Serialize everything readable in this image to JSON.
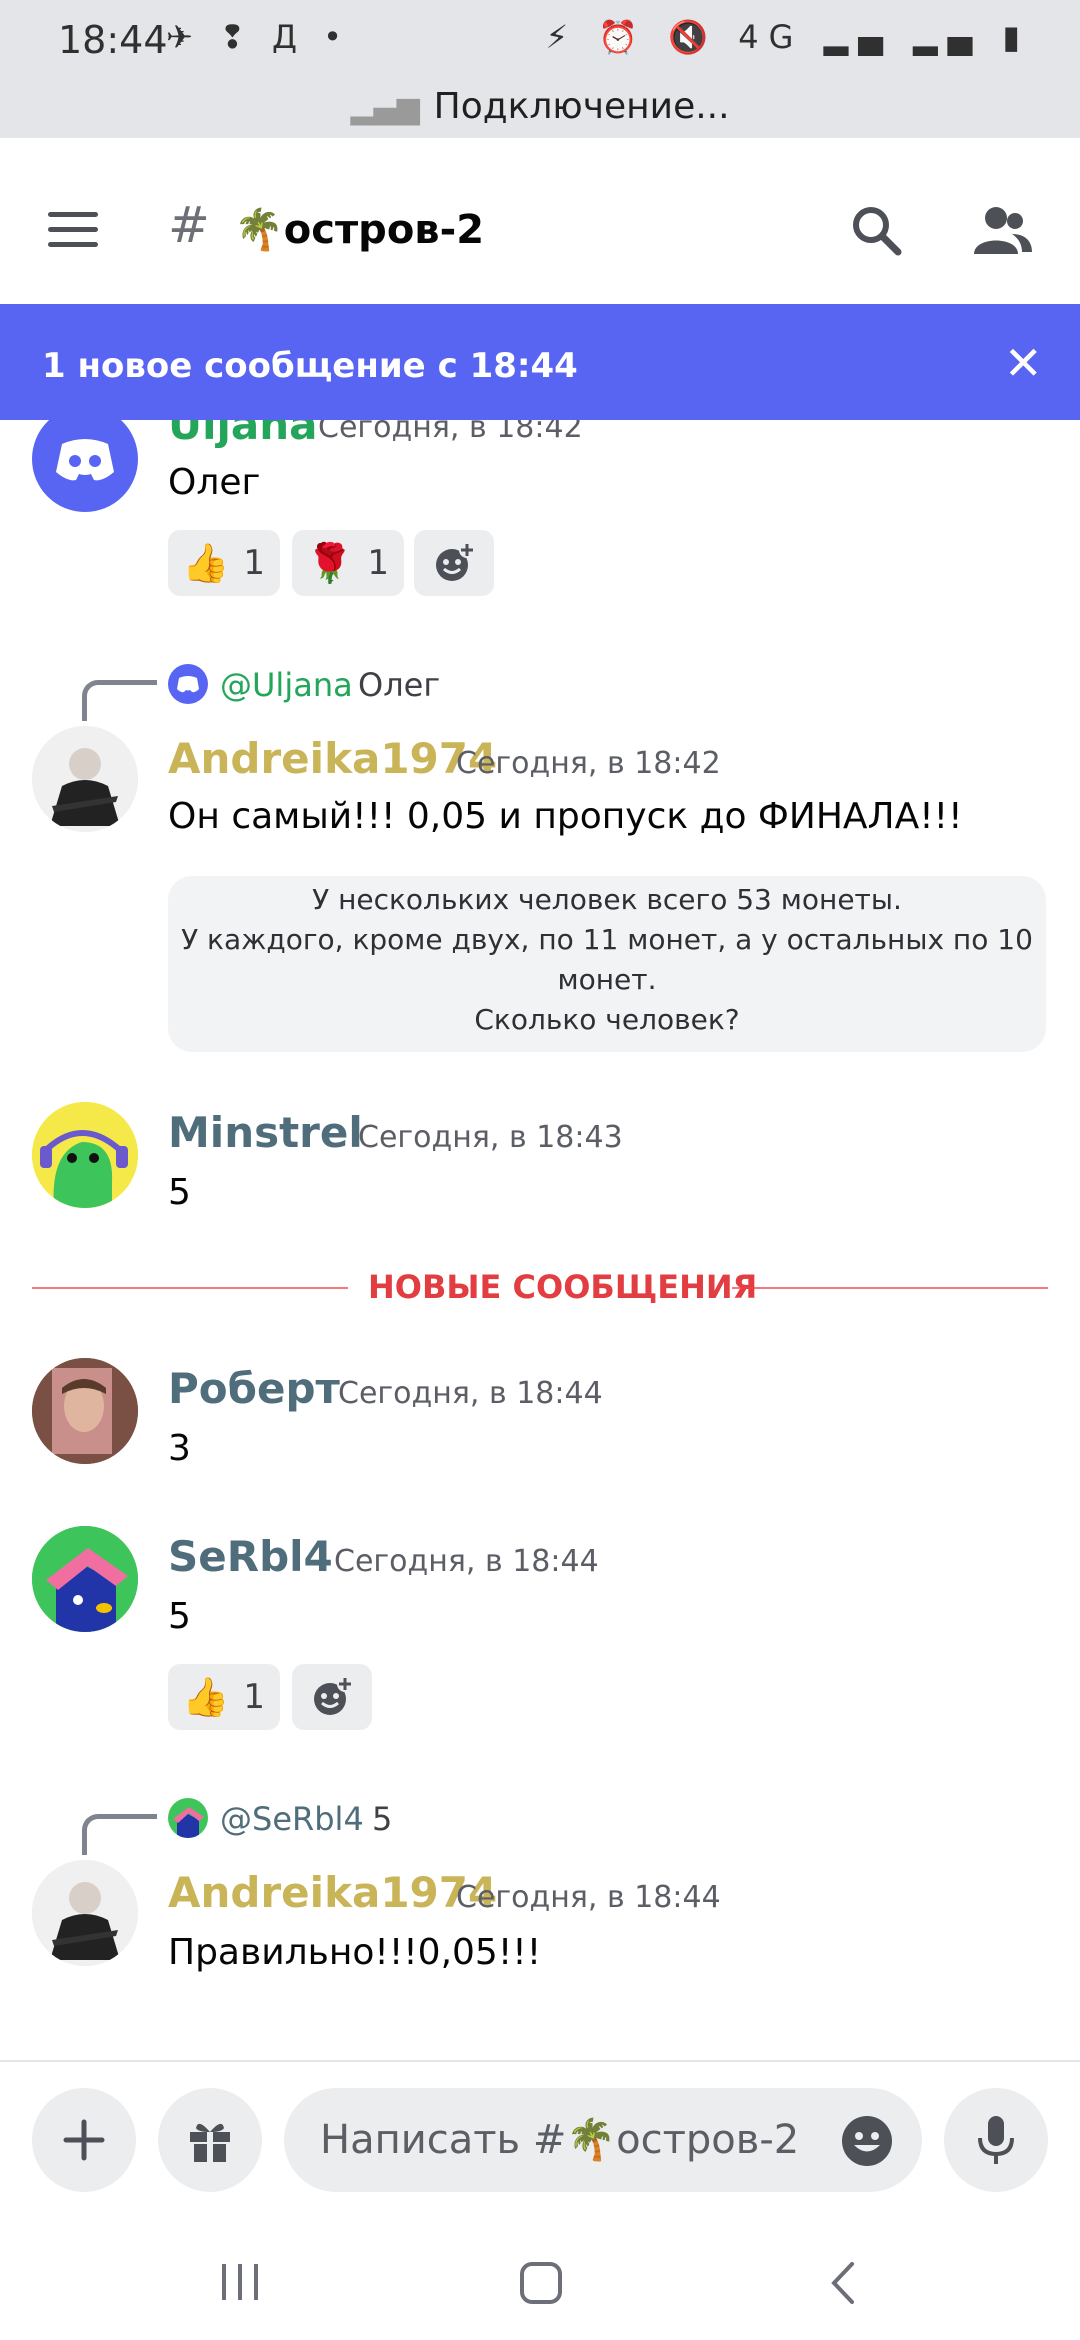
{
  "status_bar": {
    "time": "18:44",
    "left_icons": "✈ ❢ Д •",
    "right_icons": "⚡ ⏰ 🔇 4G ▂▄ ▂▄ ▮",
    "connection_text": "Подключение..."
  },
  "header": {
    "hash": "#",
    "channel_name": "🌴остров-2"
  },
  "banner": {
    "text": "1 новое сообщение с 18:44",
    "close": "✕"
  },
  "messages": [
    {
      "author": "Uljana",
      "author_color": "#23a55a",
      "time": "Сегодня, в 18:42",
      "text": "Олег",
      "reactions": [
        {
          "emoji": "👍",
          "count": "1"
        },
        {
          "emoji": "🌹",
          "count": "1"
        }
      ]
    },
    {
      "reply_to": "@Uljana",
      "reply_text": "Олег",
      "author": "Andreika1974",
      "author_color": "#c9b458",
      "time": "Сегодня, в 18:42",
      "text": "Он самый!!! 0,05 и пропуск до ФИНАЛА!!!",
      "quote_lines": [
        "У нескольких человек всего 53 монеты.",
        "У каждого, кроме двух, по 11 монет, а у остальных по 10",
        "монет.",
        "Сколько человек?"
      ]
    },
    {
      "author": "Minstrel",
      "author_color": "#4f6d7a",
      "time": "Сегодня, в 18:43",
      "text": "5"
    },
    {
      "author": "Роберт",
      "author_color": "#4f6d7a",
      "time": "Сегодня, в 18:44",
      "text": "3"
    },
    {
      "author": "SeRbl4",
      "author_color": "#4f6d7a",
      "time": "Сегодня, в 18:44",
      "text": "5",
      "reactions": [
        {
          "emoji": "👍",
          "count": "1"
        }
      ]
    },
    {
      "reply_to": "@SeRbl4",
      "reply_text": "5",
      "author": "Andreika1974",
      "author_color": "#c9b458",
      "time": "Сегодня, в 18:44",
      "text": "Правильно!!!0,05!!!"
    }
  ],
  "divider": {
    "text": "НОВЫЕ СООБЩЕНИЯ"
  },
  "composer": {
    "placeholder": "Написать #🌴остров-2"
  },
  "colors": {
    "accent": "#5865f2",
    "new_divider": "#e23d40"
  }
}
